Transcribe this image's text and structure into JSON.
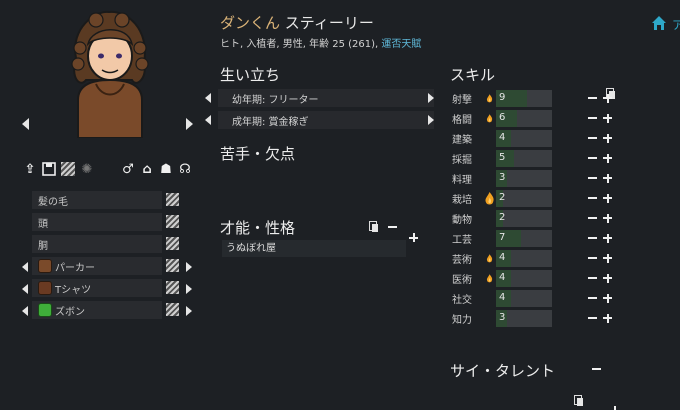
{
  "header": {
    "name_first": "ダンくん",
    "name_last": "スティーリー",
    "subtitle": "ヒト, 入植者, 男性, 年齢 25 (261), ",
    "link": "運否天賦",
    "top_right_text": "ア"
  },
  "apparel": [
    {
      "label": "髪の毛",
      "arrows": false,
      "icon": ""
    },
    {
      "label": "頭",
      "arrows": false,
      "icon": ""
    },
    {
      "label": "胴",
      "arrows": false,
      "icon": ""
    },
    {
      "label": "パーカー",
      "arrows": true,
      "icon": "parka-icon",
      "color": "#7a4a2a"
    },
    {
      "label": "Tシャツ",
      "arrows": true,
      "icon": "tshirt-icon",
      "color": "#6a3a22"
    },
    {
      "label": "ズボン",
      "arrows": true,
      "icon": "pants-icon",
      "color": "#3fae3a"
    }
  ],
  "backstory": {
    "title": "生い立ち",
    "childhood": "幼年期: フリーター",
    "adulthood": "成年期: 賞金稼ぎ"
  },
  "incapable": {
    "title": "苦手・欠点"
  },
  "traits": {
    "title": "才能・性格",
    "items": [
      "うぬぼれ屋"
    ]
  },
  "skills": {
    "title": "スキル",
    "items": [
      {
        "name": "射撃",
        "level": "9",
        "passion": 1,
        "fill": 0.55
      },
      {
        "name": "格闘",
        "level": "6",
        "passion": 1,
        "fill": 0.38
      },
      {
        "name": "建築",
        "level": "4",
        "passion": 0,
        "fill": 0.26
      },
      {
        "name": "採掘",
        "level": "5",
        "passion": 0,
        "fill": 0.32
      },
      {
        "name": "料理",
        "level": "3",
        "passion": 0,
        "fill": 0.2
      },
      {
        "name": "栽培",
        "level": "2",
        "passion": 2,
        "fill": 0.13
      },
      {
        "name": "動物",
        "level": "2",
        "passion": 0,
        "fill": 0.13
      },
      {
        "name": "工芸",
        "level": "7",
        "passion": 0,
        "fill": 0.45
      },
      {
        "name": "芸術",
        "level": "4",
        "passion": 1,
        "fill": 0.26
      },
      {
        "name": "医術",
        "level": "4",
        "passion": 1,
        "fill": 0.26
      },
      {
        "name": "社交",
        "level": "4",
        "passion": 0,
        "fill": 0.26
      },
      {
        "name": "知力",
        "level": "3",
        "passion": 0,
        "fill": 0.2
      }
    ]
  },
  "psytalent": {
    "title": "サイ・タレント"
  },
  "colors": {
    "background": "#1d2024",
    "name_accent": "#d9b277",
    "link": "#5fb8d8",
    "skill_fill": "#2e4a33",
    "passion": "#f0a020"
  }
}
